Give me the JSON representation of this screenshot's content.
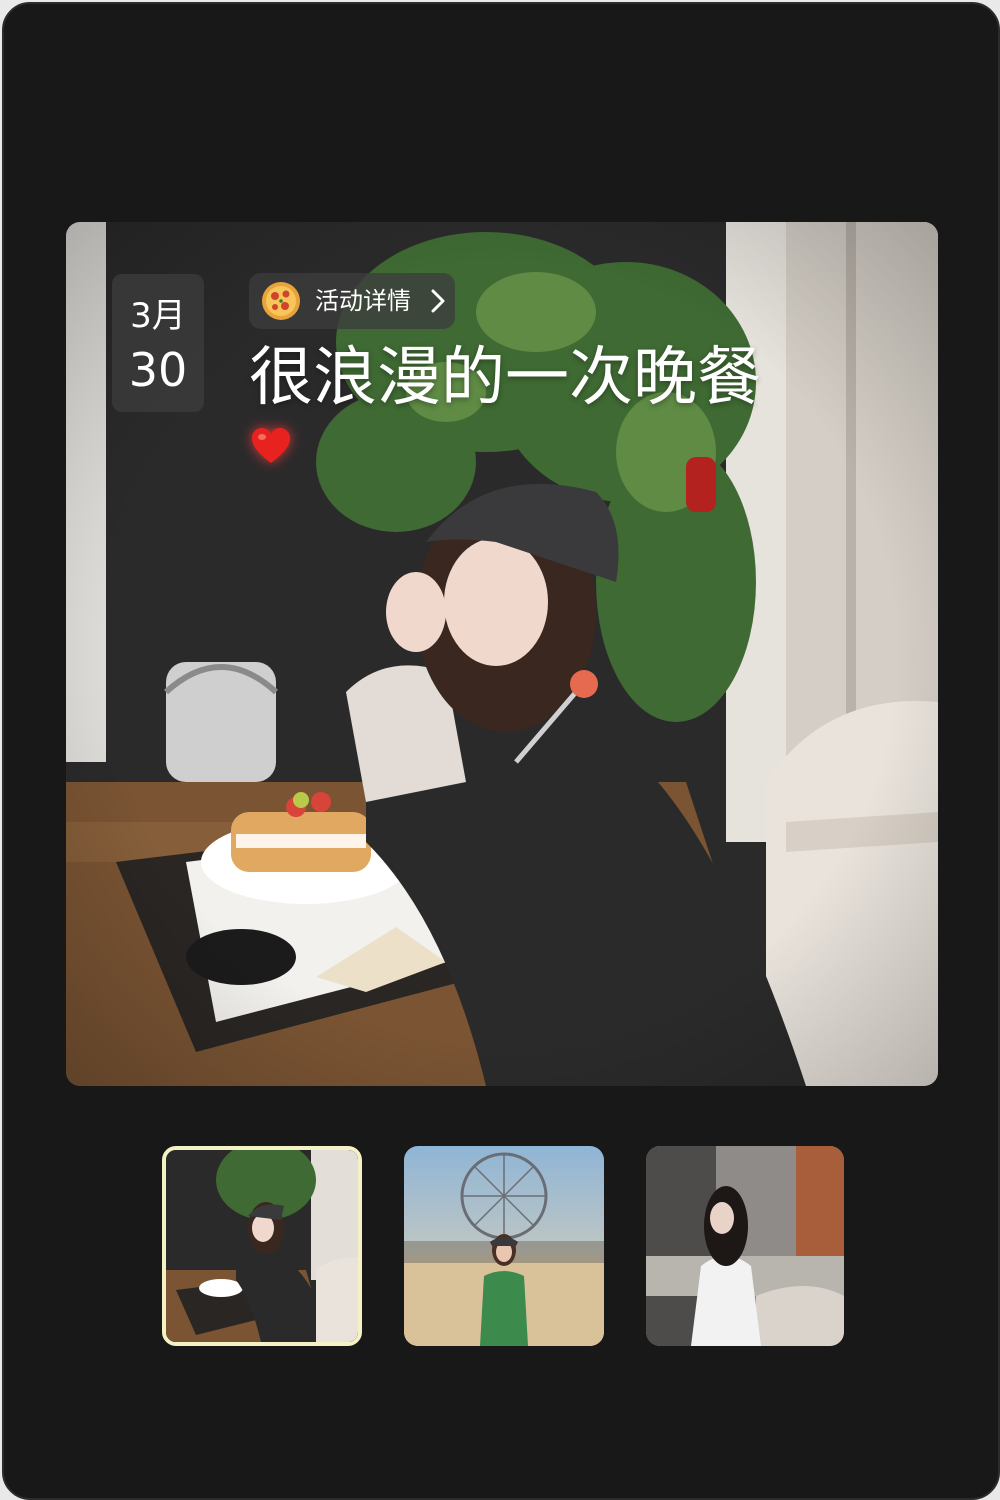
{
  "date": {
    "month": "3月",
    "day": "30"
  },
  "event_link": {
    "label": "活动详情",
    "icon": "pizza-icon"
  },
  "headline": "很浪漫的一次晚餐",
  "heart": {
    "icon": "heart-icon",
    "color": "#e8231f"
  },
  "thumbnails": [
    {
      "id": "dinner",
      "selected": true
    },
    {
      "id": "festival",
      "selected": false
    },
    {
      "id": "portrait",
      "selected": false
    }
  ],
  "colors": {
    "background": "#181818",
    "selected_border": "#f4f1c4",
    "overlay": "rgba(60,60,60,0.78)"
  }
}
